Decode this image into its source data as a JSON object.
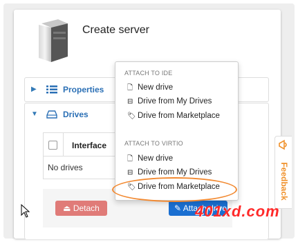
{
  "page": {
    "title": "Create server"
  },
  "properties_panel": {
    "label": "Properties"
  },
  "drives_panel": {
    "label": "Drives",
    "table": {
      "columns": [
        "Interface"
      ],
      "empty_message": "No drives"
    },
    "detach_label": "Detach",
    "attach_label": "Attach drive"
  },
  "attach_menu": {
    "sections": [
      {
        "header": "ATTACH TO IDE",
        "items": [
          {
            "icon": "file-icon",
            "label": "New drive"
          },
          {
            "icon": "hdd-icon",
            "label": "Drive from My Drives"
          },
          {
            "icon": "tags-icon",
            "label": "Drive from Marketplace"
          }
        ]
      },
      {
        "header": "ATTACH TO VIRTIO",
        "items": [
          {
            "icon": "file-icon",
            "label": "New drive"
          },
          {
            "icon": "hdd-icon",
            "label": "Drive from My Drives"
          },
          {
            "icon": "tags-icon",
            "label": "Drive from Marketplace",
            "highlighted": true
          }
        ]
      }
    ]
  },
  "feedback": {
    "label": "Feedback"
  },
  "watermark": "401xd.com",
  "colors": {
    "link": "#2a6fb5",
    "danger": "#d9534f",
    "primary": "#1a6fd1",
    "highlight": "#f28a32",
    "feedback": "#f0912b",
    "watermark": "#ff2a2a"
  }
}
